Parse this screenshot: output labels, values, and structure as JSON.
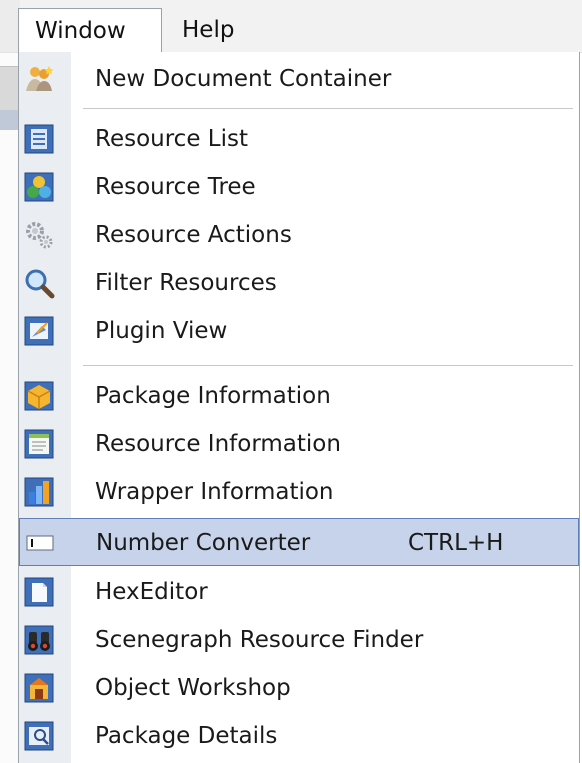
{
  "menubar": {
    "menus": [
      {
        "label": "Window",
        "active": true
      },
      {
        "label": "Help",
        "active": false
      }
    ]
  },
  "window_menu": {
    "items": [
      {
        "label": "New Document Container",
        "icon": "document-container-icon"
      },
      {
        "label": "Resource List",
        "icon": "resource-list-icon"
      },
      {
        "label": "Resource Tree",
        "icon": "resource-tree-icon"
      },
      {
        "label": "Resource Actions",
        "icon": "gears-icon"
      },
      {
        "label": "Filter Resources",
        "icon": "magnifier-icon"
      },
      {
        "label": "Plugin View",
        "icon": "plugin-view-icon"
      },
      {
        "label": "Package  Information",
        "icon": "package-icon"
      },
      {
        "label": "Resource Information",
        "icon": "resource-info-icon"
      },
      {
        "label": "Wrapper Information",
        "icon": "wrapper-info-icon"
      },
      {
        "label": "Number Converter",
        "icon": "number-converter-icon",
        "shortcut": "CTRL+H",
        "highlighted": true
      },
      {
        "label": "HexEditor",
        "icon": "hex-editor-icon"
      },
      {
        "label": "Scenegraph Resource Finder",
        "icon": "binoculars-icon"
      },
      {
        "label": "Object Workshop",
        "icon": "object-workshop-icon"
      },
      {
        "label": "Package Details",
        "icon": "package-details-icon"
      }
    ]
  },
  "colors": {
    "highlight_bg": "#c7d3ea",
    "highlight_border": "#5f7fb6",
    "gutter": "#eaeef3"
  }
}
